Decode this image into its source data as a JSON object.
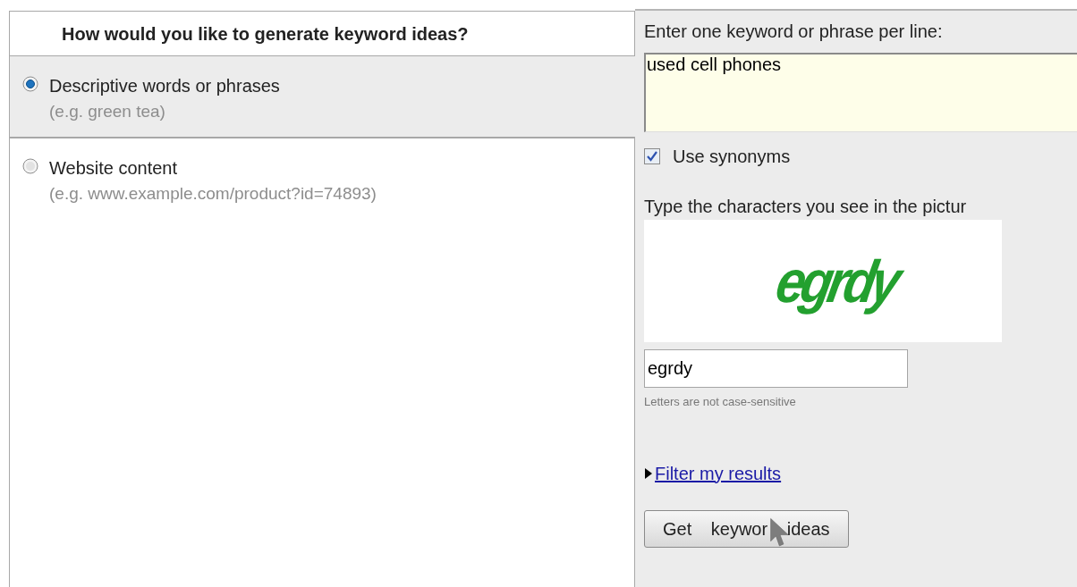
{
  "question": "How would you like to generate keyword ideas?",
  "options": [
    {
      "label": "Descriptive words or phrases",
      "example": "(e.g. green tea)",
      "selected": true
    },
    {
      "label": "Website content",
      "example": "(e.g. www.example.com/product?id=74893)",
      "selected": false
    }
  ],
  "keywords": {
    "label": "Enter one keyword or phrase per line:",
    "value": "used cell phones"
  },
  "synonyms": {
    "label": "Use synonyms",
    "checked": true
  },
  "captcha": {
    "prompt": "Type the characters you see in the pictur",
    "image_text": "egrdy",
    "value": "egrdy",
    "hint": "Letters are not case-sensitive"
  },
  "filter_link": {
    "label": "Filter my results",
    "expanded": false
  },
  "submit_button": "Get keywor ideas"
}
